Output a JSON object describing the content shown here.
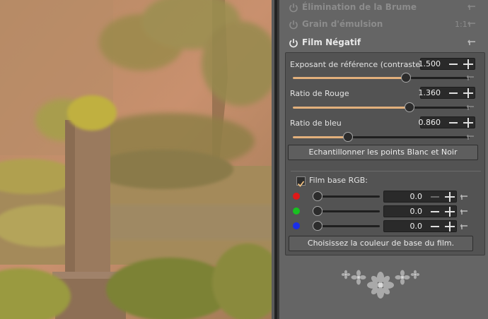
{
  "tools": [
    {
      "title": "Élimination de la Brume",
      "enabled": false
    },
    {
      "title": "Grain d'émulsion",
      "enabled": false,
      "aux": "1:1"
    },
    {
      "title": "Film Négatif",
      "enabled": true
    }
  ],
  "film_negative": {
    "sliders": [
      {
        "label": "Exposant de référence (contraste)",
        "value": "1.500",
        "level": 0.64
      },
      {
        "label": "Ratio de Rouge",
        "value": "1.360",
        "level": 0.66
      },
      {
        "label": "Ratio de bleu",
        "value": "0.860",
        "level": 0.31
      }
    ],
    "sample_button": "Echantillonner les points Blanc et Noir",
    "film_base": {
      "checkbox_label": "Film base RGB:",
      "checked": true,
      "channels": [
        {
          "name": "red",
          "color": "#e01818",
          "value": "0.0",
          "level": 0
        },
        {
          "name": "green",
          "color": "#18c020",
          "value": "0.0",
          "level": 0
        },
        {
          "name": "blue",
          "color": "#1a2ee8",
          "value": "0.0",
          "level": 0
        }
      ],
      "pick_button": "Choisissez la couleur de base du film."
    }
  },
  "colors": {
    "accent_slider": "#e2b07c",
    "panel_bg": "#656565"
  },
  "icons": [
    "power-icon",
    "reset-icon",
    "checkmark-icon",
    "flower-ornament-icon"
  ]
}
